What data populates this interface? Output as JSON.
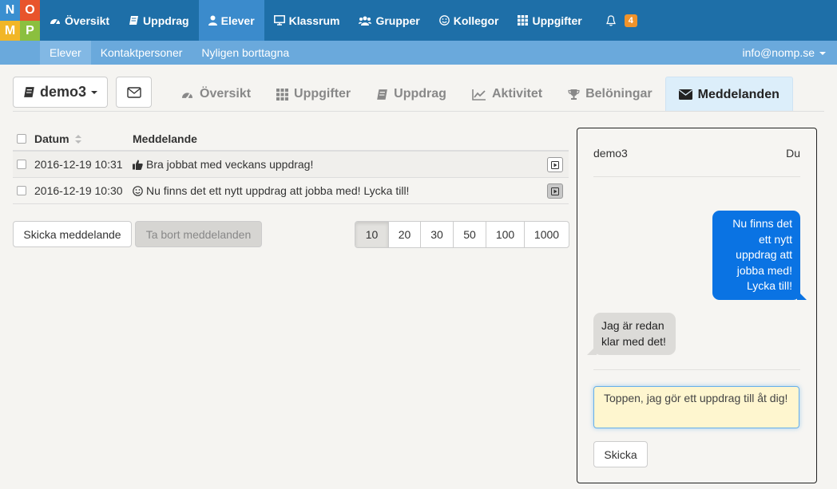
{
  "logo": {
    "letters": [
      "N",
      "O",
      "M",
      "P"
    ]
  },
  "topnav": {
    "items": [
      {
        "label": "Översikt",
        "icon": "dashboard-icon"
      },
      {
        "label": "Uppdrag",
        "icon": "book-icon"
      },
      {
        "label": "Elever",
        "icon": "user-icon",
        "active": true
      },
      {
        "label": "Klassrum",
        "icon": "monitor-icon"
      },
      {
        "label": "Grupper",
        "icon": "users-icon"
      },
      {
        "label": "Kollegor",
        "icon": "smiley-icon"
      },
      {
        "label": "Uppgifter",
        "icon": "grid-icon"
      }
    ],
    "notifications": {
      "icon": "bell-icon",
      "count": "4"
    }
  },
  "subnav": {
    "items": [
      {
        "label": "Elever",
        "active": true
      },
      {
        "label": "Kontaktpersoner"
      },
      {
        "label": "Nyligen borttagna"
      }
    ],
    "account": "info@nomp.se"
  },
  "student": {
    "name": "demo3"
  },
  "tabs": [
    {
      "label": "Översikt",
      "icon": "dashboard-icon"
    },
    {
      "label": "Uppgifter",
      "icon": "grid-icon"
    },
    {
      "label": "Uppdrag",
      "icon": "book-icon"
    },
    {
      "label": "Aktivitet",
      "icon": "line-chart-icon"
    },
    {
      "label": "Belöningar",
      "icon": "trophy-icon"
    },
    {
      "label": "Meddelanden",
      "icon": "envelope-icon",
      "active": true
    }
  ],
  "table": {
    "headers": {
      "date": "Datum",
      "message": "Meddelande"
    },
    "rows": [
      {
        "date": "2016-12-19 10:31",
        "icon": "thumbs-up-icon",
        "message": "Bra jobbat med veckans uppdrag!"
      },
      {
        "date": "2016-12-19 10:30",
        "icon": "smiley-icon",
        "message": "Nu finns det ett nytt uppdrag att jobba med! Lycka till!"
      }
    ]
  },
  "actions": {
    "send_label": "Skicka meddelande",
    "delete_label": "Ta bort meddelanden"
  },
  "pagination": {
    "options": [
      "10",
      "20",
      "30",
      "50",
      "100",
      "1000"
    ],
    "selected": "10"
  },
  "chat": {
    "left_name": "demo3",
    "right_name": "Du",
    "outgoing_lines": [
      "Nu finns det",
      "ett nytt",
      "uppdrag att",
      "jobba med!",
      "Lycka till!"
    ],
    "incoming_lines": [
      "Jag är redan",
      "klar med det!"
    ],
    "input_value": "Toppen, jag gör ett uppdrag till åt dig!",
    "send_label": "Skicka"
  },
  "colors": {
    "topbar": "#1e6fa8",
    "active_nav": "#3b8bcc",
    "subbar": "#6aa9dc",
    "badge": "#f0932b",
    "active_tab": "#dceefa",
    "outgoing_bubble": "#0a73e3",
    "incoming_bubble": "#dcdbd8",
    "input_bg": "#fef6cf"
  }
}
